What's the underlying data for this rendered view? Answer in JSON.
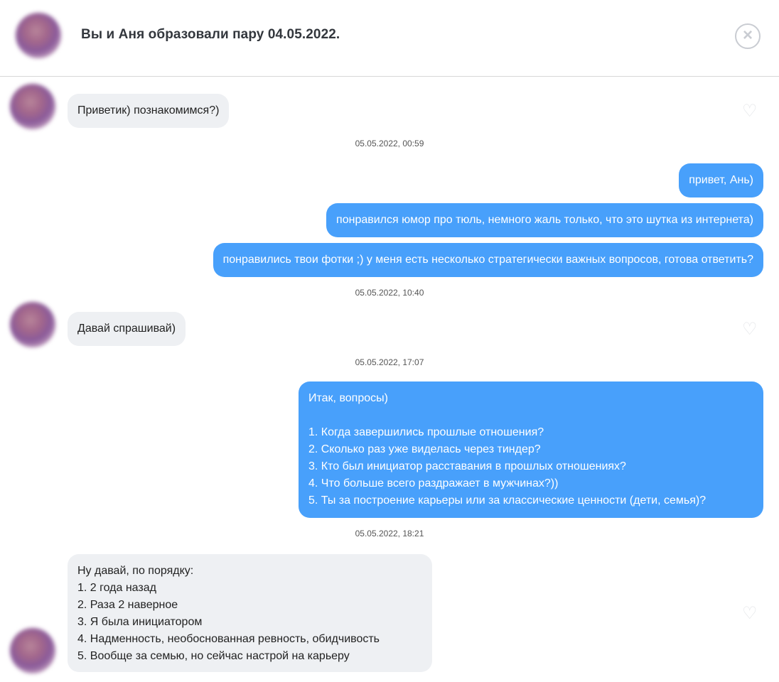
{
  "header": {
    "title": "Вы и Аня образовали пару 04.05.2022.",
    "close_icon": "close-circle-icon"
  },
  "messages": [
    {
      "direction": "incoming",
      "text": "Приветик) познакомимся?)"
    },
    {
      "timestamp": "05.05.2022, 00:59"
    },
    {
      "direction": "outgoing",
      "text": "привет, Ань)"
    },
    {
      "direction": "outgoing",
      "text": "понравился юмор про тюль, немного жаль только, что это шутка из интернета)"
    },
    {
      "direction": "outgoing",
      "text": "понравились твои фотки ;) у меня есть несколько стратегически важных вопросов, готова ответить?"
    },
    {
      "timestamp": "05.05.2022, 10:40"
    },
    {
      "direction": "incoming",
      "text": "Давай спрашивай)"
    },
    {
      "timestamp": "05.05.2022, 17:07"
    },
    {
      "direction": "outgoing",
      "text": "Итак, вопросы)\n\n1. Когда завершились прошлые отношения?\n2. Сколько раз уже виделась через тиндер?\n3. Кто был инициатор расставания в прошлых отношениях?\n4. Что больше всего раздражает в мужчинах?))\n5. Ты за построение карьеры или за классические ценности (дети, семья)?"
    },
    {
      "timestamp": "05.05.2022, 18:21"
    },
    {
      "direction": "incoming",
      "text": "Ну давай, по порядку:\n1. 2 года назад\n2. Раза 2 наверное\n3. Я была инициатором\n4. Надменность, необоснованная ревность, обидчивость\n5. Вообще за семью, но сейчас настрой на карьеру"
    }
  ],
  "icons": {
    "like": "heart-outline-icon",
    "avatar": "contact-avatar"
  },
  "colors": {
    "outgoing_bubble": "#48a0fb",
    "incoming_bubble": "#eef0f3"
  }
}
